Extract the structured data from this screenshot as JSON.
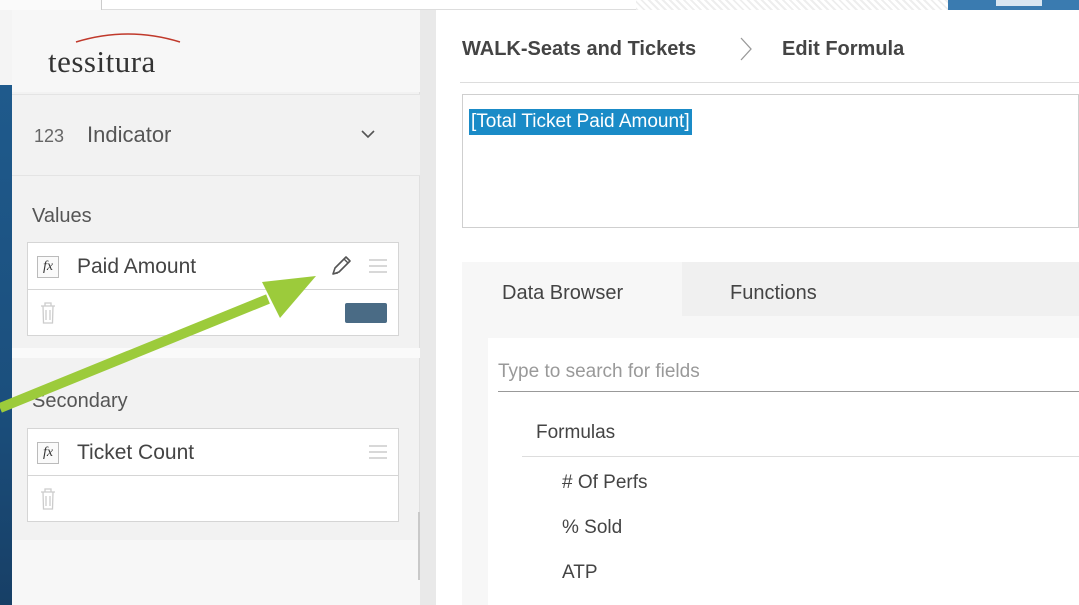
{
  "colors": {
    "accent_arrow": "#9ccb3b",
    "selection": "#1a8bc7",
    "swatch": "#4a6b85",
    "slide_strip": "#1f5a8c"
  },
  "logo": {
    "text": "tessitura"
  },
  "indicator": {
    "prefix": "123",
    "label": "Indicator",
    "icon": "chevron-down-icon"
  },
  "values_section": {
    "title": "Values",
    "field": {
      "icon": "fx-icon",
      "fx_text": "fx",
      "label": "Paid Amount"
    }
  },
  "secondary_section": {
    "title": "Secondary",
    "field": {
      "icon": "fx-icon",
      "fx_text": "fx",
      "label": "Ticket Count"
    }
  },
  "breadcrumb": {
    "parent": "WALK-Seats and Tickets",
    "current": "Edit Formula"
  },
  "formula": {
    "text": "[Total Ticket Paid Amount]"
  },
  "tabs": [
    {
      "label": "Data Browser",
      "active": true
    },
    {
      "label": "Functions",
      "active": false
    }
  ],
  "search": {
    "placeholder": "Type to search for fields",
    "value": ""
  },
  "browser": {
    "group": "Formulas",
    "items": [
      "# Of Perfs",
      "% Sold",
      "ATP"
    ]
  }
}
